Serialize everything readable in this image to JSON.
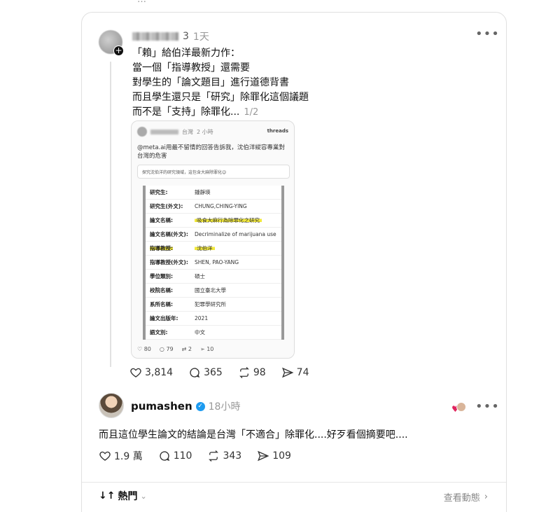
{
  "top_fragment": "…",
  "post1": {
    "author_suffix": "3",
    "time": "1天",
    "lines": [
      "「賴」給伯洋最新力作：",
      "當一個「指導教授」還需要",
      "對學生的「論文題目」進行道德背書",
      "而且學生還只是「研究」除罪化這個議題",
      "而不是「支持」除罪化..."
    ],
    "page_indicator": "1/2",
    "embed": {
      "location": "台灣",
      "time": "2 小時",
      "brand": "threads",
      "text": "@meta.ai用最不留情的回答告訴我，沈伯洋縱容專業對台灣的危害",
      "subtext": "探究沈伯洋的研究領域，這包含大麻除罪化😉",
      "rows": [
        {
          "key": "研究生:",
          "value": "鍾靜瑛"
        },
        {
          "key": "研究生(外文):",
          "value": "CHUNG,CHING-YING"
        },
        {
          "key": "論文名稱:",
          "value": "吸食大麻行為除罪化之研究"
        },
        {
          "key": "論文名稱(外文):",
          "value": "Decriminalize of marijuana use"
        },
        {
          "key": "指導教授:",
          "value": "沈伯洋"
        },
        {
          "key": "指導教授(外文):",
          "value": "SHEN, PAO-YANG"
        },
        {
          "key": "學位類別:",
          "value": "碩士"
        },
        {
          "key": "校院名稱:",
          "value": "國立臺北大學"
        },
        {
          "key": "系所名稱:",
          "value": "犯罪學研究所"
        },
        {
          "key": "論文出版年:",
          "value": "2021"
        },
        {
          "key": "語文別:",
          "value": "中文"
        }
      ],
      "stats": {
        "likes": "80",
        "replies": "79",
        "reposts": "2",
        "shares": "10"
      }
    },
    "stats": {
      "likes": "3,814",
      "replies": "365",
      "reposts": "98",
      "shares": "74"
    }
  },
  "reply": {
    "username": "pumashen",
    "time": "18小時",
    "text": "而且這位學生論文的結論是台灣「不適合」除罪化....好歹看個摘要吧....",
    "stats": {
      "likes": "1.9 萬",
      "replies": "110",
      "reposts": "343",
      "shares": "109"
    }
  },
  "footer": {
    "sort_label": "熱門",
    "activity_label": "查看動態"
  },
  "icons": {
    "more": "more-icon",
    "like": "heart-icon",
    "reply": "comment-icon",
    "repost": "repost-icon",
    "share": "send-icon"
  },
  "colors": {
    "verified": "#1d9bf0",
    "highlight": "#f2e93c",
    "liked_heart": "#e0245e"
  }
}
